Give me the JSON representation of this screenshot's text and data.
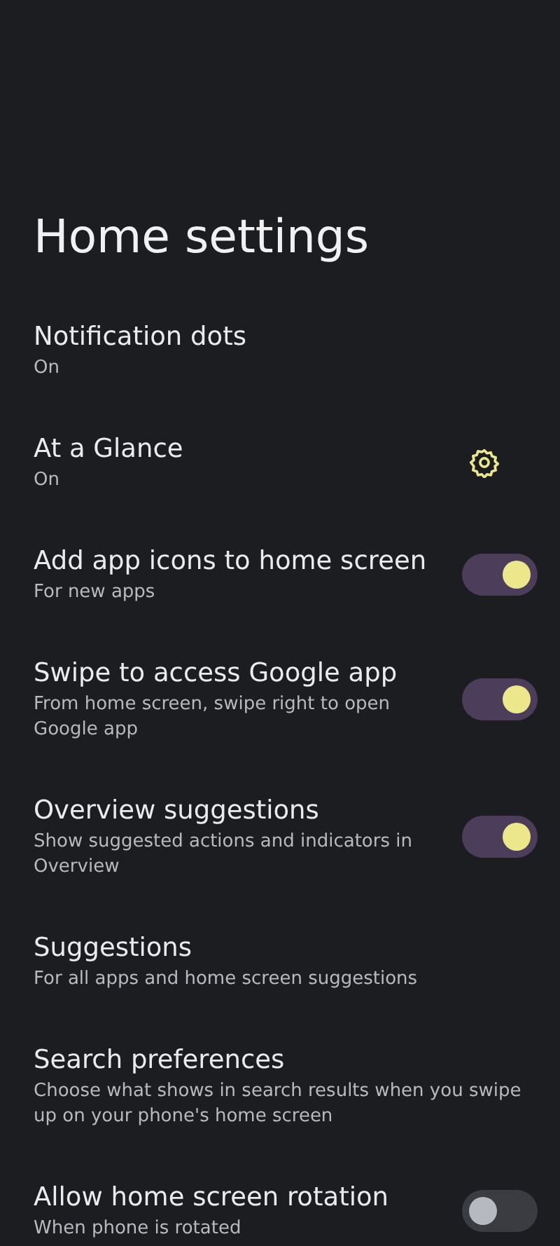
{
  "title": "Home settings",
  "items": [
    {
      "kind": "plain",
      "title": "Notification dots",
      "subtitle": "On"
    },
    {
      "kind": "gear",
      "title": "At a Glance",
      "subtitle": "On"
    },
    {
      "kind": "switch",
      "title": "Add app icons to home screen",
      "subtitle": "For new apps",
      "on": true
    },
    {
      "kind": "switch",
      "title": "Swipe to access Google app",
      "subtitle": "From home screen, swipe right to open Google app",
      "on": true
    },
    {
      "kind": "switch",
      "title": "Overview suggestions",
      "subtitle": "Show suggested actions and indicators in Overview",
      "on": true
    },
    {
      "kind": "plain",
      "title": "Suggestions",
      "subtitle": "For all apps and home screen suggestions"
    },
    {
      "kind": "plain",
      "title": "Search preferences",
      "subtitle": "Choose what shows in search results when you swipe up on your phone's home screen"
    },
    {
      "kind": "switch",
      "title": "Allow home screen rotation",
      "subtitle": "When phone is rotated",
      "on": false
    }
  ]
}
